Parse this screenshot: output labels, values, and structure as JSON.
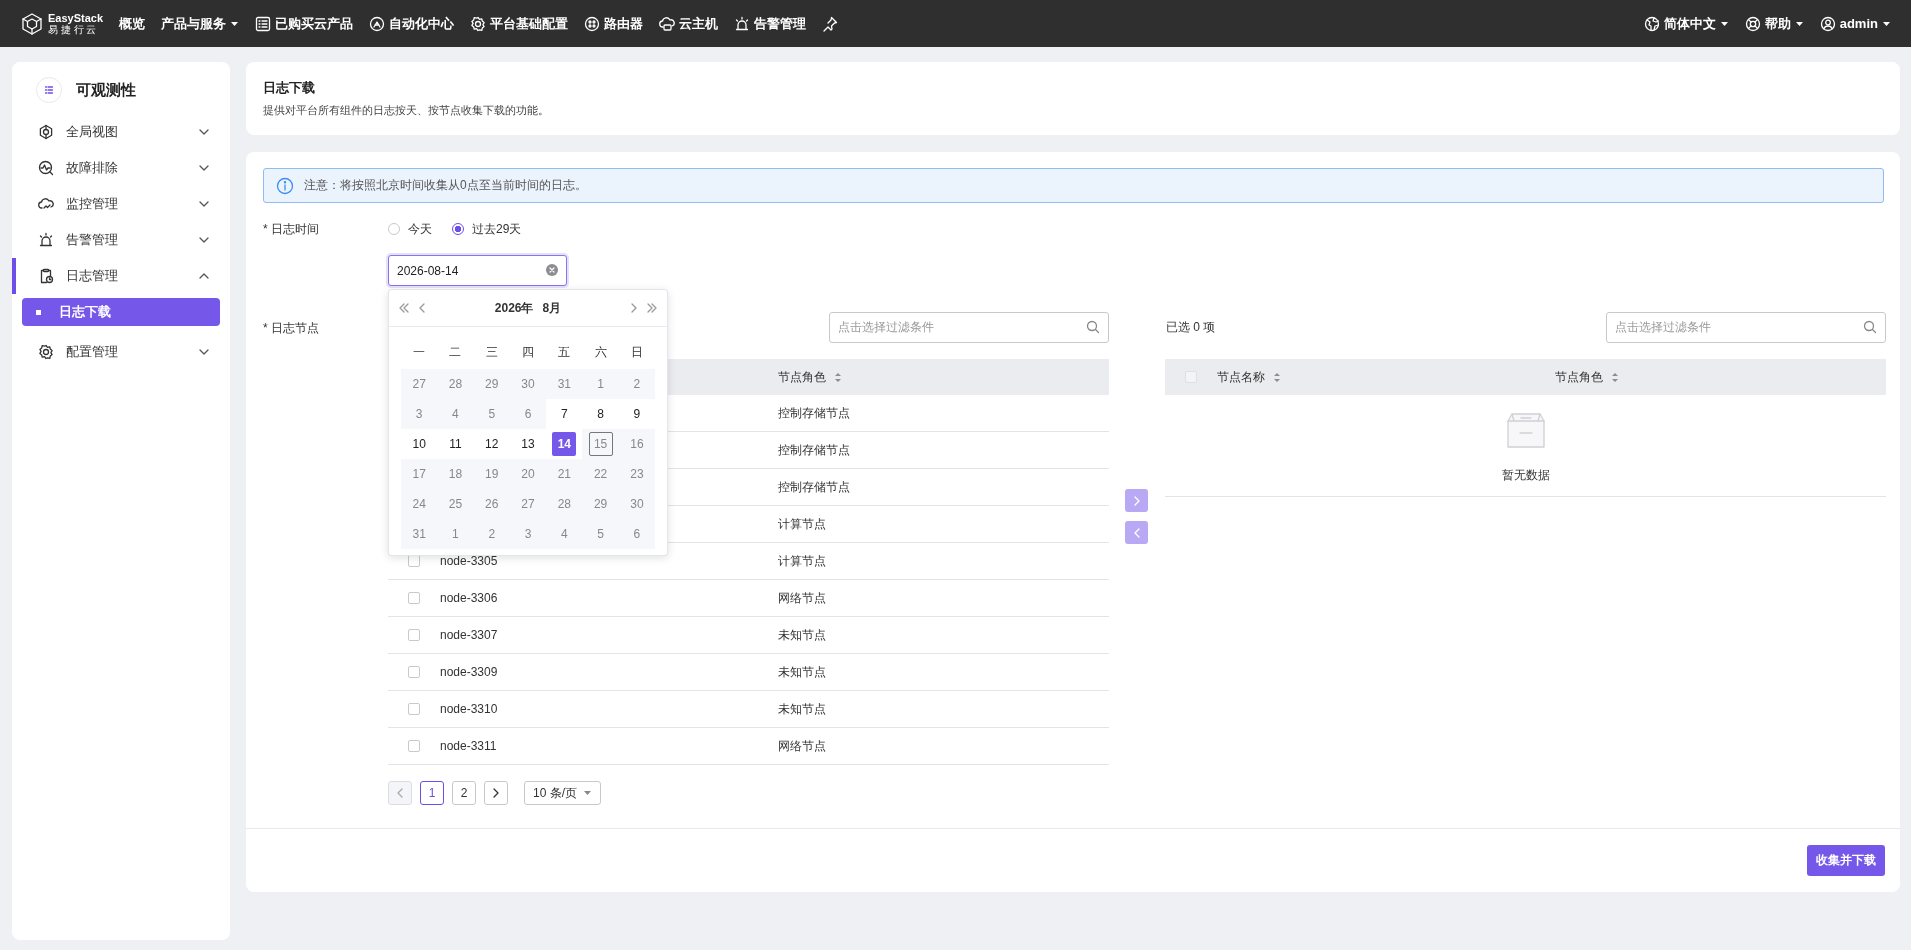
{
  "topbar": {
    "logo": {
      "name": "EasyStack",
      "subtitle": "易 捷 行 云"
    },
    "nav": [
      {
        "label": "概览",
        "dropdown": false
      },
      {
        "label": "产品与服务",
        "dropdown": true
      },
      {
        "label": "已购买云产品",
        "dropdown": false
      },
      {
        "label": "自动化中心",
        "dropdown": false
      },
      {
        "label": "平台基础配置",
        "dropdown": false
      },
      {
        "label": "路由器",
        "dropdown": false
      },
      {
        "label": "云主机",
        "dropdown": false
      },
      {
        "label": "告警管理",
        "dropdown": false
      }
    ],
    "right": [
      {
        "label": "简体中文",
        "dropdown": true
      },
      {
        "label": "帮助",
        "dropdown": true
      },
      {
        "label": "admin",
        "dropdown": true
      }
    ]
  },
  "sidebar": {
    "title": "可观测性",
    "items": [
      {
        "label": "全局视图",
        "expanded": false,
        "selected": false
      },
      {
        "label": "故障排除",
        "expanded": false,
        "selected": false
      },
      {
        "label": "监控管理",
        "expanded": false,
        "selected": false
      },
      {
        "label": "告警管理",
        "expanded": false,
        "selected": false
      },
      {
        "label": "日志管理",
        "expanded": true,
        "selected": true,
        "children": [
          {
            "label": "日志下载",
            "selected": true
          }
        ]
      },
      {
        "label": "配置管理",
        "expanded": false,
        "selected": false
      }
    ]
  },
  "header": {
    "title": "日志下载",
    "description": "提供对平台所有组件的日志按天、按节点收集下载的功能。"
  },
  "notice": "注意：将按照北京时间收集从0点至当前时间的日志。",
  "time": {
    "label": "* 日志时间",
    "options": [
      {
        "label": "今天",
        "selected": false
      },
      {
        "label": "过去29天",
        "selected": true
      }
    ],
    "date": {
      "value": "2026-08-14"
    },
    "calendar": {
      "year": "2026年",
      "month": "8月",
      "weekdays": [
        "一",
        "二",
        "三",
        "四",
        "五",
        "六",
        "日"
      ],
      "weeks": [
        {
          "days": [
            {
              "day": "27",
              "disabled": true,
              "selected": false,
              "today": false
            },
            {
              "day": "28",
              "disabled": true,
              "selected": false,
              "today": false
            },
            {
              "day": "29",
              "disabled": true,
              "selected": false,
              "today": false
            },
            {
              "day": "30",
              "disabled": true,
              "selected": false,
              "today": false
            },
            {
              "day": "31",
              "disabled": true,
              "selected": false,
              "today": false
            },
            {
              "day": "1",
              "disabled": true,
              "selected": false,
              "today": false
            },
            {
              "day": "2",
              "disabled": true,
              "selected": false,
              "today": false
            }
          ]
        },
        {
          "days": [
            {
              "day": "3",
              "disabled": true,
              "selected": false,
              "today": false
            },
            {
              "day": "4",
              "disabled": true,
              "selected": false,
              "today": false
            },
            {
              "day": "5",
              "disabled": true,
              "selected": false,
              "today": false
            },
            {
              "day": "6",
              "disabled": true,
              "selected": false,
              "today": false
            },
            {
              "day": "7",
              "disabled": false,
              "selected": false,
              "today": false
            },
            {
              "day": "8",
              "disabled": false,
              "selected": false,
              "today": false
            },
            {
              "day": "9",
              "disabled": false,
              "selected": false,
              "today": false
            }
          ]
        },
        {
          "days": [
            {
              "day": "10",
              "disabled": false,
              "selected": false,
              "today": false
            },
            {
              "day": "11",
              "disabled": false,
              "selected": false,
              "today": false
            },
            {
              "day": "12",
              "disabled": false,
              "selected": false,
              "today": false
            },
            {
              "day": "13",
              "disabled": false,
              "selected": false,
              "today": false
            },
            {
              "day": "14",
              "disabled": false,
              "selected": true,
              "today": false
            },
            {
              "day": "15",
              "disabled": true,
              "selected": false,
              "today": true
            },
            {
              "day": "16",
              "disabled": true,
              "selected": false,
              "today": false
            }
          ]
        },
        {
          "days": [
            {
              "day": "17",
              "disabled": true,
              "selected": false,
              "today": false
            },
            {
              "day": "18",
              "disabled": true,
              "selected": false,
              "today": false
            },
            {
              "day": "19",
              "disabled": true,
              "selected": false,
              "today": false
            },
            {
              "day": "20",
              "disabled": true,
              "selected": false,
              "today": false
            },
            {
              "day": "21",
              "disabled": true,
              "selected": false,
              "today": false
            },
            {
              "day": "22",
              "disabled": true,
              "selected": false,
              "today": false
            },
            {
              "day": "23",
              "disabled": true,
              "selected": false,
              "today": false
            }
          ]
        },
        {
          "days": [
            {
              "day": "24",
              "disabled": true,
              "selected": false,
              "today": false
            },
            {
              "day": "25",
              "disabled": true,
              "selected": false,
              "today": false
            },
            {
              "day": "26",
              "disabled": true,
              "selected": false,
              "today": false
            },
            {
              "day": "27",
              "disabled": true,
              "selected": false,
              "today": false
            },
            {
              "day": "28",
              "disabled": true,
              "selected": false,
              "today": false
            },
            {
              "day": "29",
              "disabled": true,
              "selected": false,
              "today": false
            },
            {
              "day": "30",
              "disabled": true,
              "selected": false,
              "today": false
            }
          ]
        },
        {
          "days": [
            {
              "day": "31",
              "disabled": true,
              "selected": false,
              "today": false
            },
            {
              "day": "1",
              "disabled": true,
              "selected": false,
              "today": false
            },
            {
              "day": "2",
              "disabled": true,
              "selected": false,
              "today": false
            },
            {
              "day": "3",
              "disabled": true,
              "selected": false,
              "today": false
            },
            {
              "day": "4",
              "disabled": true,
              "selected": false,
              "today": false
            },
            {
              "day": "5",
              "disabled": true,
              "selected": false,
              "today": false
            },
            {
              "day": "6",
              "disabled": true,
              "selected": false,
              "today": false
            }
          ]
        }
      ]
    }
  },
  "nodes": {
    "label": "* 日志节点",
    "source": {
      "filter_placeholder": "点击选择过滤条件",
      "role_column": "节点角色",
      "rows": [
        {
          "role": "控制存储节点"
        },
        {
          "role": "控制存储节点"
        },
        {
          "role": "控制存储节点"
        },
        {
          "role": "计算节点"
        },
        {
          "checked": false,
          "name": "node-3305",
          "role": "计算节点"
        },
        {
          "checked": false,
          "name": "node-3306",
          "role": "网络节点"
        },
        {
          "checked": false,
          "name": "node-3307",
          "role": "未知节点"
        },
        {
          "checked": false,
          "name": "node-3309",
          "role": "未知节点"
        },
        {
          "checked": false,
          "name": "node-3310",
          "role": "未知节点"
        },
        {
          "checked": false,
          "name": "node-3311",
          "role": "网络节点"
        }
      ],
      "pagination": {
        "prev_disabled": true,
        "pages": [
          {
            "label": "1",
            "selected": true
          },
          {
            "label": "2",
            "selected": false
          }
        ],
        "next_disabled": false,
        "page_size": "10 条/页"
      }
    },
    "transfer_buttons": [
      {
        "kind": "right",
        "disabled": true
      },
      {
        "kind": "left",
        "disabled": true
      }
    ],
    "target": {
      "count": "已选 0 项",
      "filter_placeholder": "点击选择过滤条件",
      "select_all": {
        "checked": false,
        "disabled": true
      },
      "columns": [
        "节点名称",
        "节点角色"
      ],
      "empty": "暂无数据"
    }
  },
  "submit": "收集并下载"
}
